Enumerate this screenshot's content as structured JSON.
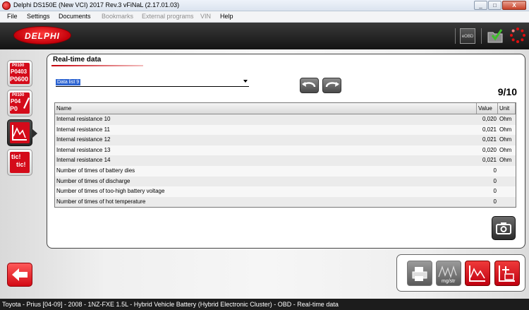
{
  "window": {
    "title": "Delphi DS150E (New VCI) 2017 Rev.3 vFiNaL (2.17.01.03)",
    "buttons": {
      "minimize": "_",
      "maximize": "□",
      "close": "X"
    }
  },
  "menu": {
    "items": [
      {
        "label": "File",
        "enabled": true
      },
      {
        "label": "Settings",
        "enabled": true
      },
      {
        "label": "Documents",
        "enabled": true
      },
      {
        "label": "Bookmarks",
        "enabled": false
      },
      {
        "label": "External programs",
        "enabled": false
      },
      {
        "label": "VIN",
        "enabled": false
      },
      {
        "label": "Help",
        "enabled": true
      }
    ]
  },
  "header": {
    "logo_text": "DELPHI",
    "obd_label": "eOBD"
  },
  "left_tools": [
    {
      "name": "fault-codes-button",
      "icon": "fault-codes-icon",
      "lines": [
        "P0100",
        "P0403",
        "P0600"
      ]
    },
    {
      "name": "clear-codes-button",
      "icon": "clear-codes-icon",
      "lines": [
        "P0100",
        "P04",
        "P0"
      ]
    },
    {
      "name": "realtime-data-button",
      "icon": "realtime-graph-icon",
      "lines": []
    },
    {
      "name": "activation-button",
      "icon": "tic-tic-icon",
      "lines": [
        "tic!",
        "tic!"
      ]
    }
  ],
  "panel": {
    "title": "Real-time data",
    "data_list": {
      "selected": "Data list 9"
    },
    "page_indicator": "9/10",
    "table": {
      "columns": {
        "name": "Name",
        "value": "Value",
        "unit": "Unit"
      },
      "rows": [
        {
          "name": "Internal resistance 10",
          "value": "0,020",
          "unit": "Ohm"
        },
        {
          "name": "Internal resistance 11",
          "value": "0,021",
          "unit": "Ohm"
        },
        {
          "name": "Internal resistance 12",
          "value": "0,021",
          "unit": "Ohm"
        },
        {
          "name": "Internal resistance 13",
          "value": "0,020",
          "unit": "Ohm"
        },
        {
          "name": "Internal resistance 14",
          "value": "0,021",
          "unit": "Ohm"
        },
        {
          "name": "Number of times of battery dies",
          "value": "0",
          "unit": ""
        },
        {
          "name": "Number of times of discharge",
          "value": "0",
          "unit": ""
        },
        {
          "name": "Number of times of too-high battery voltage",
          "value": "0",
          "unit": ""
        },
        {
          "name": "Number of times of hot temperature",
          "value": "0",
          "unit": ""
        }
      ]
    }
  },
  "bottom_tools": [
    {
      "name": "print-button",
      "icon": "printer-icon"
    },
    {
      "name": "units-button",
      "icon": "units-icon",
      "label": "mg/str"
    },
    {
      "name": "graph-button",
      "icon": "graph-icon"
    },
    {
      "name": "snapshot-record-button",
      "icon": "record-icon"
    }
  ],
  "status": {
    "text": "Toyota - Prius [04-09] - 2008 - 1NZ-FXE 1.5L - Hybrid Vehicle Battery (Hybrid Electronic Cluster) - OBD - Real-time data"
  },
  "colors": {
    "brand_red": "#d40b1a",
    "header_bg": "#1e1e1e",
    "status_bg": "#1c1c1c"
  }
}
